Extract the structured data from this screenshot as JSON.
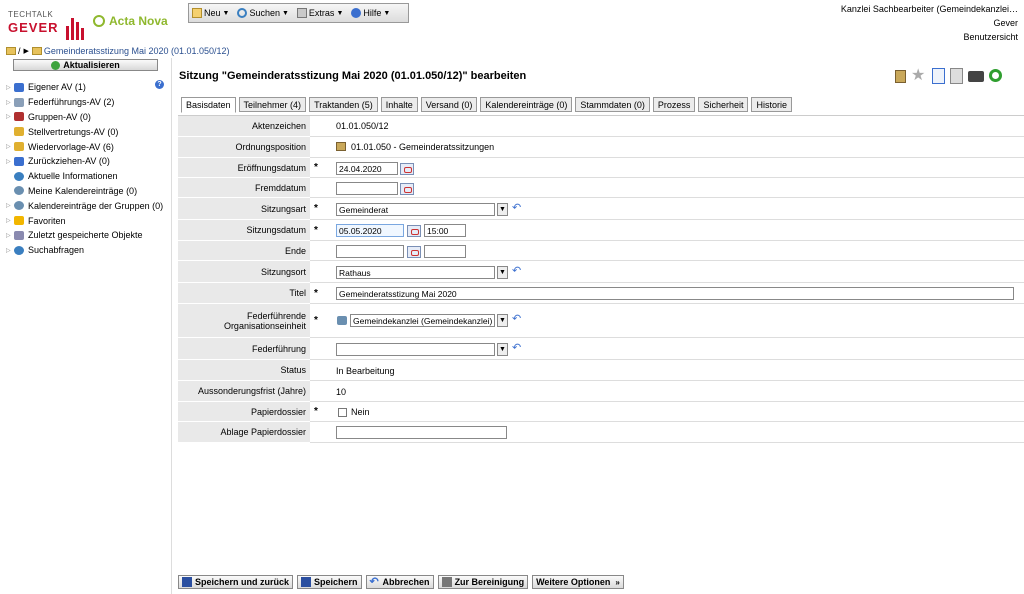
{
  "header": {
    "brand_small": "TECHTALK",
    "brand_big": "GEVER",
    "product": "Acta Nova",
    "menu": [
      "Neu",
      "Suchen",
      "Extras",
      "Hilfe"
    ],
    "user_line1": "Kanzlei Sachbearbeiter (Gemeindekanzlei…",
    "user_line2": "Gever",
    "user_line3": "Benutzersicht"
  },
  "breadcrumb": {
    "root": "/",
    "item": "Gemeinderatsstizung Mai 2020 (01.01.050/12)"
  },
  "sidebar": {
    "refresh_label": "Aktualisieren",
    "items": [
      {
        "label": "Eigener AV (1)",
        "color": "#3b6fcf"
      },
      {
        "label": "Federführungs-AV (2)",
        "color": "#8a9fb8"
      },
      {
        "label": "Gruppen-AV (0)",
        "color": "#b03030"
      },
      {
        "label": "Stellvertretungs-AV (0)",
        "color": "#e0b030"
      },
      {
        "label": "Wiedervorlage-AV (6)",
        "color": "#e0b030"
      },
      {
        "label": "Zurückziehen-AV (0)",
        "color": "#3b6fcf"
      },
      {
        "label": "Aktuelle Informationen",
        "color": "#3a7fc0"
      },
      {
        "label": "Meine Kalendereinträge (0)",
        "color": "#6a8fb0"
      },
      {
        "label": "Kalendereinträge der Gruppen (0)",
        "color": "#6a8fb0"
      },
      {
        "label": "Favoriten",
        "color": "#f2b600"
      },
      {
        "label": "Zuletzt gespeicherte Objekte",
        "color": "#8a8ab0"
      },
      {
        "label": "Suchabfragen",
        "color": "#3a7fc0"
      }
    ]
  },
  "main": {
    "title": "Sitzung \"Gemeinderatsstizung Mai 2020 (01.01.050/12)\" bearbeiten",
    "tabs": [
      "Basisdaten",
      "Teilnehmer (4)",
      "Traktanden (5)",
      "Inhalte",
      "Versand (0)",
      "Kalendereinträge (0)",
      "Stammdaten (0)",
      "Prozess",
      "Sicherheit",
      "Historie"
    ],
    "form": {
      "aktenzeichen_label": "Aktenzeichen",
      "aktenzeichen_value": "01.01.050/12",
      "ordnungsposition_label": "Ordnungsposition",
      "ordnungsposition_value": "01.01.050 - Gemeinderatssitzungen",
      "eroeffnungsdatum_label": "Eröffnungsdatum",
      "eroeffnungsdatum_value": "24.04.2020",
      "fremddatum_label": "Fremddatum",
      "fremddatum_value": "",
      "sitzungsart_label": "Sitzungsart",
      "sitzungsart_value": "Gemeinderat",
      "sitzungsdatum_label": "Sitzungsdatum",
      "sitzungsdatum_value": "05.05.2020",
      "sitzungszeit_value": "15:00",
      "ende_label": "Ende",
      "sitzungsort_label": "Sitzungsort",
      "sitzungsort_value": "Rathaus",
      "titel_label": "Titel",
      "titel_value": "Gemeinderatsstizung Mai 2020",
      "federfuehrende_label": "Federführende Organisationseinheit",
      "federfuehrende_value": "Gemeindekanzlei (Gemeindekanzlei)",
      "federfuehrung_label": "Federführung",
      "status_label": "Status",
      "status_value": "In Bearbeitung",
      "aussonderung_label": "Aussonderungsfrist (Jahre)",
      "aussonderung_value": "10",
      "papierdossier_label": "Papierdossier",
      "papierdossier_value": "Nein",
      "ablage_label": "Ablage Papierdossier"
    }
  },
  "bottom": {
    "save_back": "Speichern und zurück",
    "save": "Speichern",
    "cancel": "Abbrechen",
    "cleanup": "Zur Bereinigung",
    "more": "Weitere Optionen"
  }
}
